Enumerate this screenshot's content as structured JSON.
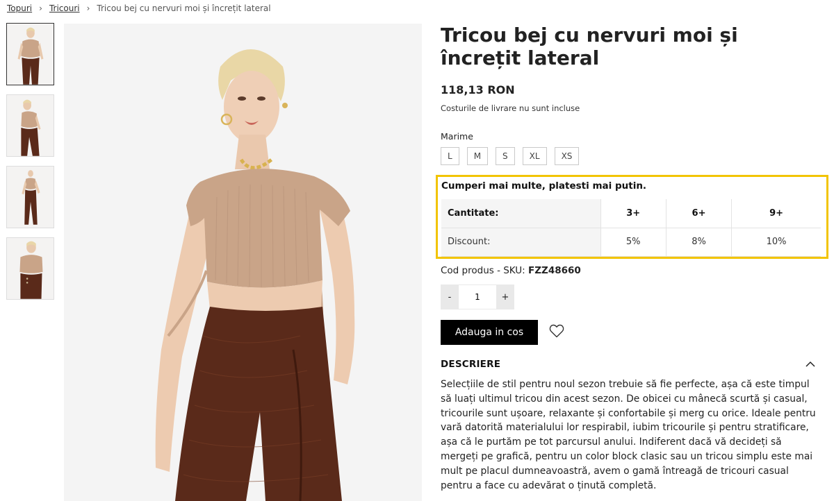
{
  "breadcrumb": {
    "items": [
      "Topuri",
      "Tricouri"
    ],
    "separator": ">",
    "current": "Tricou bej cu nervuri moi și încrețit lateral"
  },
  "gallery": {
    "thumbnails": [
      "Tricou bej - imagine 1",
      "Tricou bej - imagine 2",
      "Tricou bej - imagine 3",
      "Tricou bej - imagine 4"
    ],
    "active_index": 0
  },
  "product": {
    "title": "Tricou bej cu nervuri moi și încrețit lateral",
    "price": "118,13 RON",
    "shipping_note": "Costurile de livrare nu sunt incluse",
    "size_label": "Marime",
    "sizes": [
      "L",
      "M",
      "S",
      "XL",
      "XS"
    ],
    "sku_label": "Cod produs - SKU:",
    "sku_value": "FZZ48660"
  },
  "promo": {
    "title": "Cumperi mai multe, platesti mai putin.",
    "row1_label": "Cantitate:",
    "row2_label": "Discount:",
    "quantities": [
      "3+",
      "6+",
      "9+"
    ],
    "discounts": [
      "5%",
      "8%",
      "10%"
    ],
    "border_color": "#f2c400"
  },
  "quantity": {
    "minus": "-",
    "value": "1",
    "plus": "+"
  },
  "actions": {
    "add_to_cart": "Adauga in cos"
  },
  "description": {
    "heading": "DESCRIERE",
    "text": "Selecțiile de stil pentru noul sezon trebuie să fie perfecte, așa că este timpul să luați ultimul tricou din acest sezon. De obicei cu mânecă scurtă și casual, tricourile sunt ușoare, relaxante și confortabile și merg cu orice. Ideale pentru vară datorită materialului lor respirabil, iubim tricourile și pentru stratificare, așa că le purtăm pe tot parcursul anului. Indiferent dacă vă decideți să mergeți pe grafică, pentru un color block clasic sau un tricou simplu este mai mult pe placul dumneavoastră, avem o gamă întreagă de tricouri casual pentru a face cu adevărat o ținută completă."
  },
  "icons": {
    "wishlist": "heart-icon",
    "collapse": "chevron-up-icon",
    "breadcrumb_separator": "chevron-right-icon"
  },
  "colors": {
    "accent": "#f2c400",
    "button": "#000000",
    "top": "#c9a488",
    "pants": "#5a2a1a"
  }
}
